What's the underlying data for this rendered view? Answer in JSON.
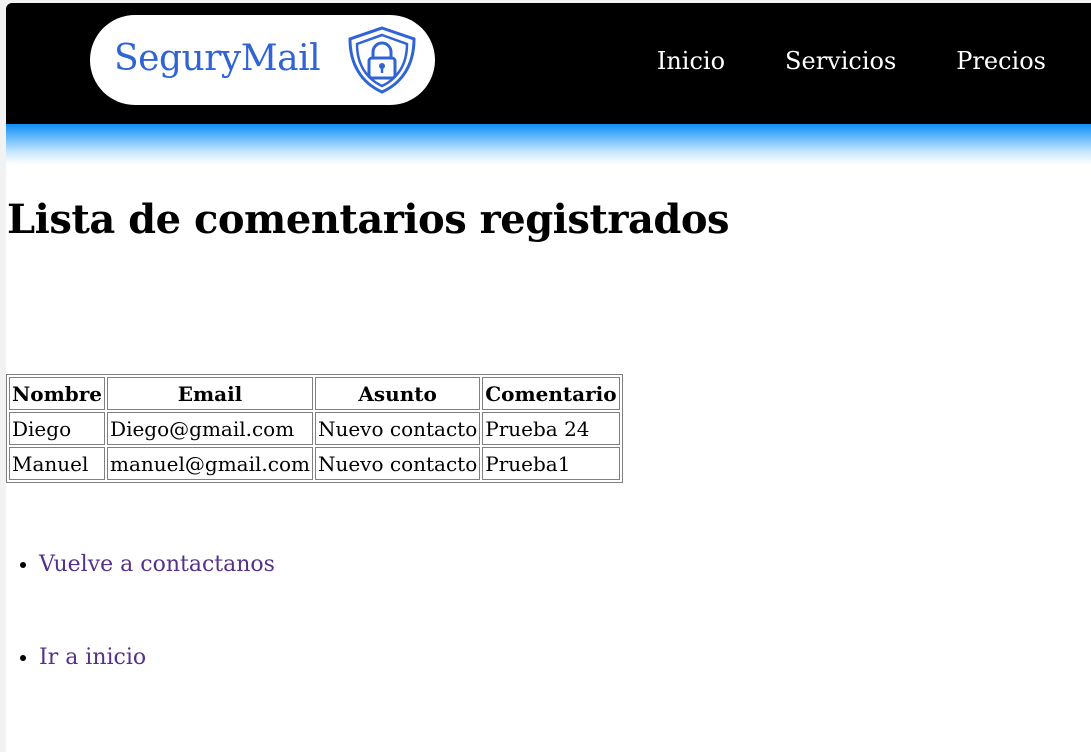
{
  "header": {
    "logo_text": "SeguryMail",
    "logo_icon": "shield-lock-icon",
    "nav": [
      {
        "label": "Inicio"
      },
      {
        "label": "Servicios"
      },
      {
        "label": "Precios"
      }
    ]
  },
  "main": {
    "title": "Lista de comentarios registrados",
    "table": {
      "headers": [
        "Nombre",
        "Email",
        "Asunto",
        "Comentario"
      ],
      "rows": [
        [
          "Diego",
          "Diego@gmail.com",
          "Nuevo contacto",
          "Prueba 24"
        ],
        [
          "Manuel",
          "manuel@gmail.com",
          "Nuevo contacto",
          "Prueba1"
        ]
      ]
    },
    "links": [
      {
        "label": "Vuelve a contactanos"
      },
      {
        "label": "Ir a inicio"
      }
    ]
  },
  "colors": {
    "header_bg": "#000000",
    "logo_blue": "#2f63d6",
    "band_blue": "#0f8ef5",
    "link_visited": "#55318a"
  }
}
